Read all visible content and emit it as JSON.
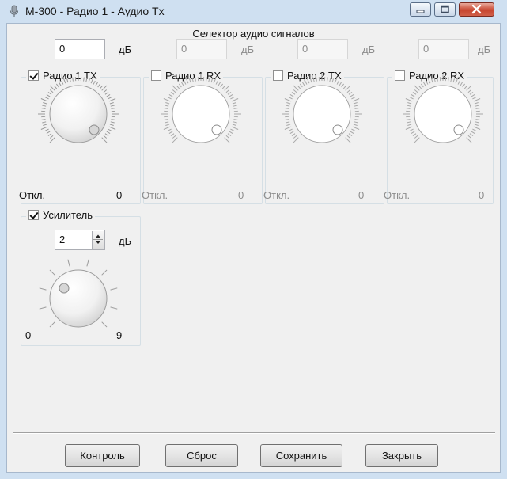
{
  "window": {
    "title": "M-300 - Радио 1 - Аудио Tx",
    "icon": "microphone-icon",
    "controls": [
      "minimize-icon",
      "maximize-icon",
      "close-icon"
    ]
  },
  "selector": {
    "caption": "Селектор аудио сигналов",
    "channels": [
      {
        "label": "Радио 1 TX",
        "checked": true,
        "value": "0",
        "unit": "дБ",
        "min_label": "Откл.",
        "max_label": "0",
        "enabled": true
      },
      {
        "label": "Радио 1 RX",
        "checked": false,
        "value": "0",
        "unit": "дБ",
        "min_label": "Откл.",
        "max_label": "0",
        "enabled": false
      },
      {
        "label": "Радио 2 TX",
        "checked": false,
        "value": "0",
        "unit": "дБ",
        "min_label": "Откл.",
        "max_label": "0",
        "enabled": false
      },
      {
        "label": "Радио 2 RX",
        "checked": false,
        "value": "0",
        "unit": "дБ",
        "min_label": "Откл.",
        "max_label": "0",
        "enabled": false
      }
    ]
  },
  "amplifier": {
    "label": "Усилитель",
    "checked": true,
    "value": "2",
    "unit": "дБ",
    "min_label": "0",
    "max_label": "9"
  },
  "buttons": {
    "control": "Контроль",
    "reset": "Сброс",
    "save": "Сохранить",
    "close": "Закрыть"
  }
}
